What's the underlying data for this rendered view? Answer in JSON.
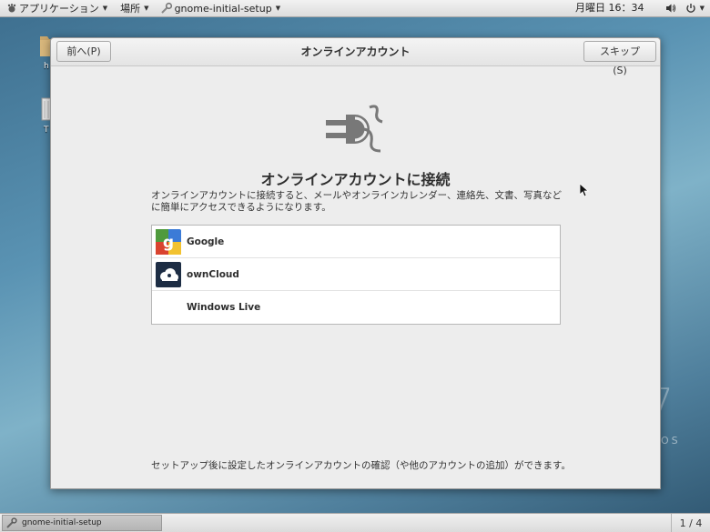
{
  "top_bar": {
    "applications": "アプリケーション",
    "places": "場所",
    "focused_app": "gnome-initial-setup",
    "clock": "月曜日 16：34"
  },
  "desktop": {
    "home_label": "h",
    "trash_label": "T",
    "watermark": "NTOS"
  },
  "window": {
    "title": "オンラインアカウント",
    "back_button": "前へ(P)",
    "skip_button": "スキップ(S)",
    "heading": "オンラインアカウントに接続",
    "description": "オンラインアカウントに接続すると、メールやオンラインカレンダー、連絡先、文書、写真などに簡単にアクセスできるようになります。",
    "accounts": [
      {
        "label": "Google",
        "icon": "google-icon"
      },
      {
        "label": "ownCloud",
        "icon": "owncloud-icon"
      },
      {
        "label": "Windows Live",
        "icon": "none"
      }
    ],
    "footnote": "セットアップ後に設定したオンラインアカウントの確認（や他のアカウントの追加）ができます。"
  },
  "bottom_bar": {
    "task_label": "gnome-initial-setup",
    "workspace": "1 / 4"
  }
}
